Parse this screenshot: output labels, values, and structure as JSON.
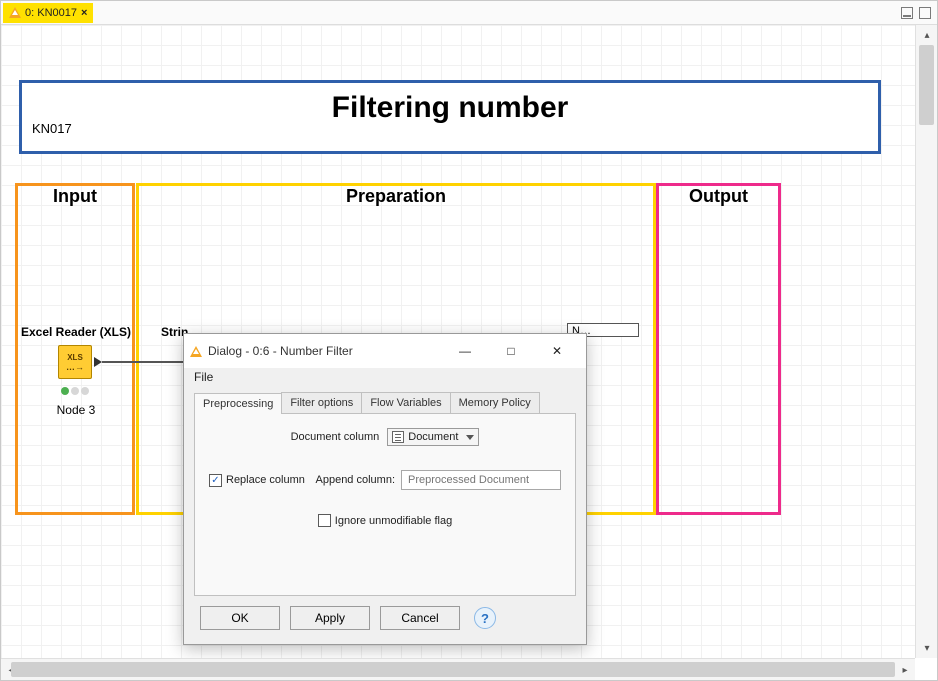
{
  "tab": {
    "label": "0: KN0017"
  },
  "titlebox": {
    "pid": "KN017",
    "heading": "Filtering number"
  },
  "groups": {
    "input": "Input",
    "prep": "Preparation",
    "output": "Output"
  },
  "node": {
    "title": "Excel Reader (XLS)",
    "icon_text": "XLS",
    "label": "Node 3"
  },
  "partial_nodes": {
    "strings_to_doc": "Strin",
    "number_filter_chip": "N…"
  },
  "dialog": {
    "title": "Dialog - 0:6 - Number Filter",
    "menu": {
      "file": "File"
    },
    "tabs": {
      "preprocessing": "Preprocessing",
      "filter_options": "Filter options",
      "flow_variables": "Flow Variables",
      "memory_policy": "Memory Policy"
    },
    "fields": {
      "document_column_label": "Document column",
      "document_column_value": "Document",
      "replace_column_label": "Replace column",
      "replace_column_checked": true,
      "append_column_label": "Append column:",
      "append_column_placeholder": "Preprocessed Document",
      "ignore_flag_label": "Ignore unmodifiable flag",
      "ignore_flag_checked": false
    },
    "buttons": {
      "ok": "OK",
      "apply": "Apply",
      "cancel": "Cancel"
    }
  }
}
